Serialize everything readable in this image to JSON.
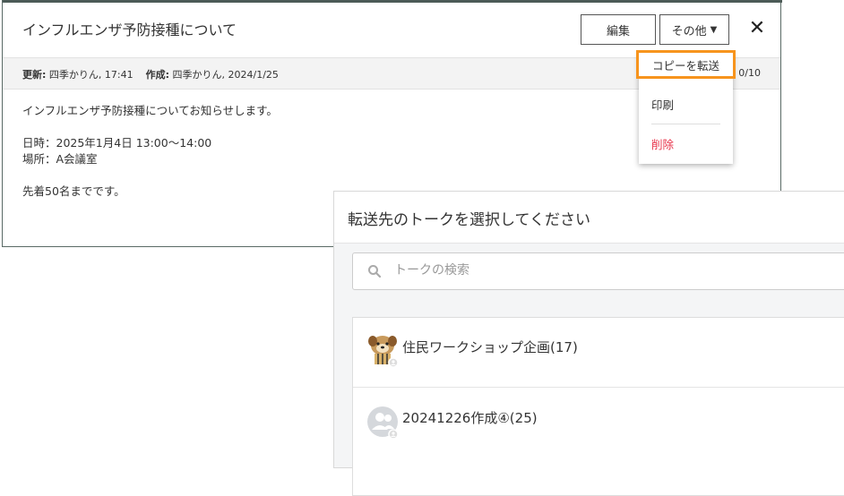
{
  "note": {
    "title": "インフルエンザ予防接種について",
    "edit_label": "編集",
    "more_label": "その他",
    "meta": {
      "updated_label": "更新:",
      "updated_value": " 四季かりん, 17:41",
      "created_label": "作成:",
      "created_value": " 四季かりん, 2024/1/25",
      "right_text": "0/10"
    },
    "body": {
      "line1": "インフルエンザ予防接種についてお知らせします。",
      "line2": "日時：2025年1月4日 13:00～14:00",
      "line3": "場所：A会議室",
      "line4": "先着50名までです。"
    }
  },
  "dropdown": {
    "copy_forward": "コピーを転送",
    "print": "印刷",
    "delete": "削除"
  },
  "forward_dialog": {
    "title": "転送先のトークを選択してください",
    "search_placeholder": "トークの検索",
    "talks": [
      {
        "label": "住民ワークショップ企画(17)",
        "avatar": "dog-avatar-icon"
      },
      {
        "label": "20241226作成④(25)",
        "avatar": "group-avatar-icon"
      }
    ]
  },
  "colors": {
    "highlight": "#f7941d",
    "delete": "#e8334a"
  }
}
